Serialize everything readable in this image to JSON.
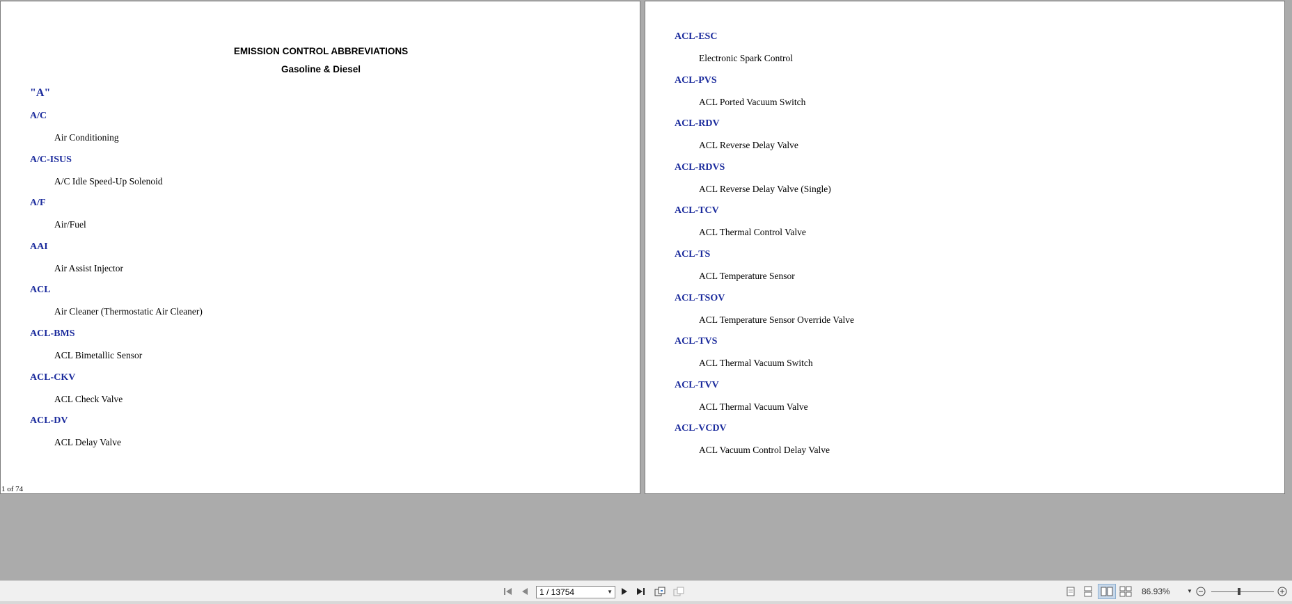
{
  "document": {
    "title": "EMISSION CONTROL ABBREVIATIONS",
    "subtitle": "Gasoline & Diesel",
    "section_letter": "\"A\"",
    "page_footer": "1 of 74",
    "left_entries": [
      {
        "term": "A/C",
        "definition": "Air Conditioning"
      },
      {
        "term": "A/C-ISUS",
        "definition": "A/C Idle Speed-Up Solenoid"
      },
      {
        "term": "A/F",
        "definition": "Air/Fuel"
      },
      {
        "term": "AAI",
        "definition": "Air Assist Injector"
      },
      {
        "term": "ACL",
        "definition": "Air Cleaner (Thermostatic Air Cleaner)"
      },
      {
        "term": "ACL-BMS",
        "definition": "ACL Bimetallic Sensor"
      },
      {
        "term": "ACL-CKV",
        "definition": "ACL Check Valve"
      },
      {
        "term": "ACL-DV",
        "definition": "ACL Delay Valve"
      }
    ],
    "right_entries": [
      {
        "term": "ACL-ESC",
        "definition": "Electronic Spark Control"
      },
      {
        "term": "ACL-PVS",
        "definition": "ACL Ported Vacuum Switch"
      },
      {
        "term": "ACL-RDV",
        "definition": "ACL Reverse Delay Valve"
      },
      {
        "term": "ACL-RDVS",
        "definition": "ACL Reverse Delay Valve (Single)"
      },
      {
        "term": "ACL-TCV",
        "definition": "ACL Thermal Control Valve"
      },
      {
        "term": "ACL-TS",
        "definition": "ACL Temperature Sensor"
      },
      {
        "term": "ACL-TSOV",
        "definition": "ACL Temperature Sensor Override Valve"
      },
      {
        "term": "ACL-TVS",
        "definition": "ACL Thermal Vacuum Switch"
      },
      {
        "term": "ACL-TVV",
        "definition": "ACL Thermal Vacuum Valve"
      },
      {
        "term": "ACL-VCDV",
        "definition": "ACL Vacuum Control Delay Valve"
      }
    ]
  },
  "toolbar": {
    "page_indicator": "1 / 13754",
    "zoom_level": "86.93%",
    "icons": [
      "first-page-icon",
      "previous-page-icon",
      "next-page-icon",
      "last-page-icon",
      "previous-view-icon",
      "next-view-icon",
      "single-page-icon",
      "continuous-icon",
      "facing-icon",
      "continuous-facing-icon",
      "zoom-out-icon",
      "zoom-in-icon"
    ]
  },
  "colors": {
    "term": "#1a2a9c",
    "background": "#ababab",
    "toolbar": "#f0f0f0"
  }
}
